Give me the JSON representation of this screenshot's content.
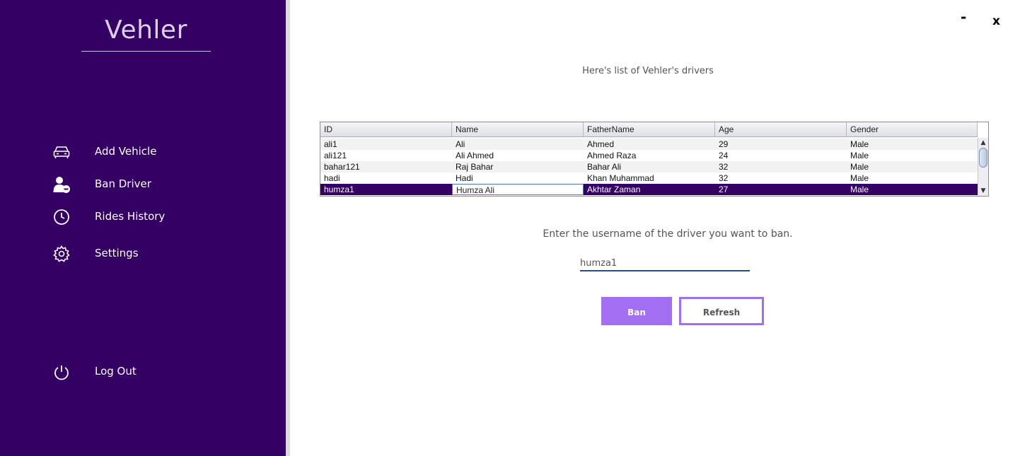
{
  "app": {
    "title": "Vehler"
  },
  "window": {
    "minimize_label": "-",
    "close_label": "x"
  },
  "sidebar": {
    "items": [
      {
        "label": "Add Vehicle",
        "icon": "car-icon"
      },
      {
        "label": "Ban Driver",
        "icon": "remove-user-icon"
      },
      {
        "label": "Rides History",
        "icon": "clock-icon"
      },
      {
        "label": "Settings",
        "icon": "gear-icon"
      }
    ],
    "logout": {
      "label": "Log Out",
      "icon": "power-icon"
    }
  },
  "main": {
    "heading": "Here's list of Vehler's drivers",
    "table": {
      "columns": [
        "ID",
        "Name",
        "FatherName",
        "Age",
        "Gender"
      ],
      "rows": [
        [
          "ali1",
          "Ali",
          "Ahmed",
          "29",
          "Male"
        ],
        [
          "ali121",
          "Ali Ahmed",
          "Ahmed Raza",
          "24",
          "Male"
        ],
        [
          "bahar121",
          "Raj Bahar",
          "Bahar Ali",
          "32",
          "Male"
        ],
        [
          "hadi",
          "Hadi",
          "Khan Muhammad",
          "32",
          "Male"
        ],
        [
          "humza1",
          "Humza Ali",
          "Akhtar Zaman",
          "27",
          "Male"
        ]
      ],
      "selected_row": "humza1"
    },
    "prompt": "Enter the username of the driver you want to ban.",
    "username_value": "humza1",
    "ban_label": "Ban",
    "refresh_label": "Refresh"
  },
  "colors": {
    "sidebar_bg": "#340064",
    "accent": "#a26ef2",
    "selected_row": "#340064"
  }
}
